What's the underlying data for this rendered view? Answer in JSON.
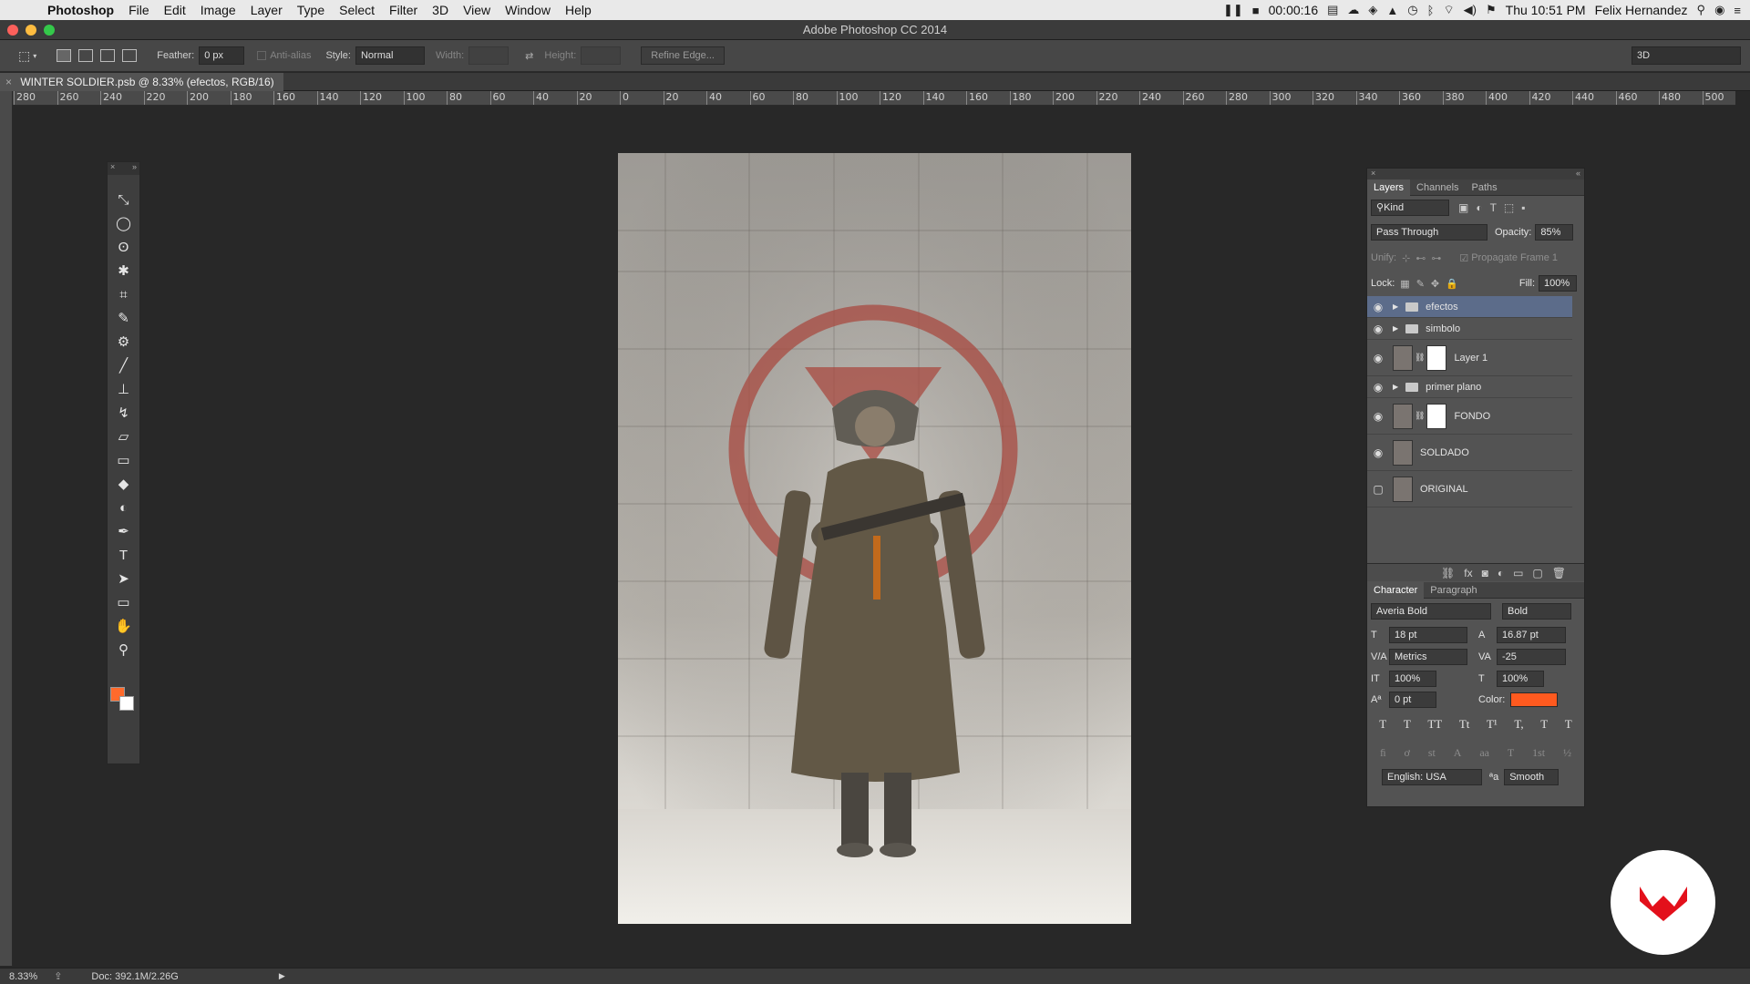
{
  "menubar": {
    "app_name": "Photoshop",
    "items": [
      "File",
      "Edit",
      "Image",
      "Layer",
      "Type",
      "Select",
      "Filter",
      "3D",
      "View",
      "Window",
      "Help"
    ],
    "timer": "00:00:16",
    "clock": "Thu 10:51 PM",
    "user": "Felix Hernandez"
  },
  "window": {
    "title": "Adobe Photoshop CC 2014"
  },
  "options": {
    "feather_label": "Feather:",
    "feather_value": "0 px",
    "antialias_label": "Anti-alias",
    "style_label": "Style:",
    "style_value": "Normal",
    "width_label": "Width:",
    "height_label": "Height:",
    "refine_edge": "Refine Edge...",
    "workspace": "3D"
  },
  "document": {
    "tab_title": "WINTER SOLDIER.psb @ 8.33% (efectos, RGB/16)"
  },
  "ruler": {
    "ticks": [
      "280",
      "260",
      "240",
      "220",
      "200",
      "180",
      "160",
      "140",
      "120",
      "100",
      "80",
      "60",
      "40",
      "20",
      "0",
      "20",
      "40",
      "60",
      "80",
      "100",
      "120",
      "140",
      "160",
      "180",
      "200",
      "220",
      "240",
      "260",
      "280",
      "300",
      "320",
      "340",
      "360",
      "380",
      "400",
      "420",
      "440",
      "460",
      "480",
      "500"
    ]
  },
  "tools": {
    "icons": [
      "move-icon",
      "ellipse-marquee-icon",
      "lasso-icon",
      "magic-wand-icon",
      "crop-icon",
      "eyedropper-icon",
      "patch-icon",
      "brush-icon",
      "stamp-icon",
      "history-brush-icon",
      "eraser-icon",
      "gradient-icon",
      "blur-icon",
      "dodge-icon",
      "pen-icon",
      "type-icon",
      "path-select-icon",
      "rectangle-icon",
      "hand-icon",
      "zoom-icon"
    ],
    "glyphs": [
      "⤡",
      "◯",
      "ʘ",
      "✱",
      "⌗",
      "✎",
      "⚙",
      "╱",
      "⊥",
      "↯",
      "▱",
      "▭",
      "◆",
      "◐",
      "✒",
      "T",
      "➤",
      "▭",
      "✋",
      "⚲"
    ],
    "foreground_color": "#ff6a2b",
    "background_color": "#ffffff"
  },
  "layers_panel": {
    "tabs": [
      "Layers",
      "Channels",
      "Paths"
    ],
    "filter_kind": "Kind",
    "blend_mode": "Pass Through",
    "opacity_label": "Opacity:",
    "opacity_value": "85%",
    "unify_label": "Unify:",
    "propagate_label": "Propagate Frame 1",
    "lock_label": "Lock:",
    "fill_label": "Fill:",
    "fill_value": "100%",
    "layers": [
      {
        "name": "efectos",
        "type": "group",
        "visible": true,
        "active": true
      },
      {
        "name": "simbolo",
        "type": "group",
        "visible": true,
        "active": false
      },
      {
        "name": "Layer 1",
        "type": "layer-mask",
        "visible": true,
        "active": false
      },
      {
        "name": "primer plano",
        "type": "group",
        "visible": true,
        "active": false
      },
      {
        "name": "FONDO",
        "type": "layer-mask",
        "visible": true,
        "active": false
      },
      {
        "name": "SOLDADO",
        "type": "layer",
        "visible": true,
        "active": false
      },
      {
        "name": "ORIGINAL",
        "type": "layer",
        "visible": false,
        "active": false
      }
    ]
  },
  "character_panel": {
    "tabs": [
      "Character",
      "Paragraph"
    ],
    "font_family": "Averia Bold",
    "font_style": "Bold",
    "size": "18 pt",
    "leading": "16.87 pt",
    "kerning": "Metrics",
    "tracking": "-25",
    "vertical_scale": "100%",
    "horizontal_scale": "100%",
    "baseline_shift": "0 pt",
    "color_label": "Color:",
    "text_color": "#ff5a1f",
    "language": "English: USA",
    "antialias": "Smooth",
    "aa_label": "ªa",
    "type_styles": [
      "T",
      "T",
      "TT",
      "Tt",
      "T¹",
      "T,",
      "T",
      "T"
    ],
    "opentype": [
      "ﬁ",
      "ơ",
      "st",
      "A",
      "aa",
      "T",
      "1st",
      "½"
    ]
  },
  "status": {
    "zoom": "8.33%",
    "doc": "Doc: 392.1M/2.26G"
  },
  "logo_color": "#e3101b"
}
